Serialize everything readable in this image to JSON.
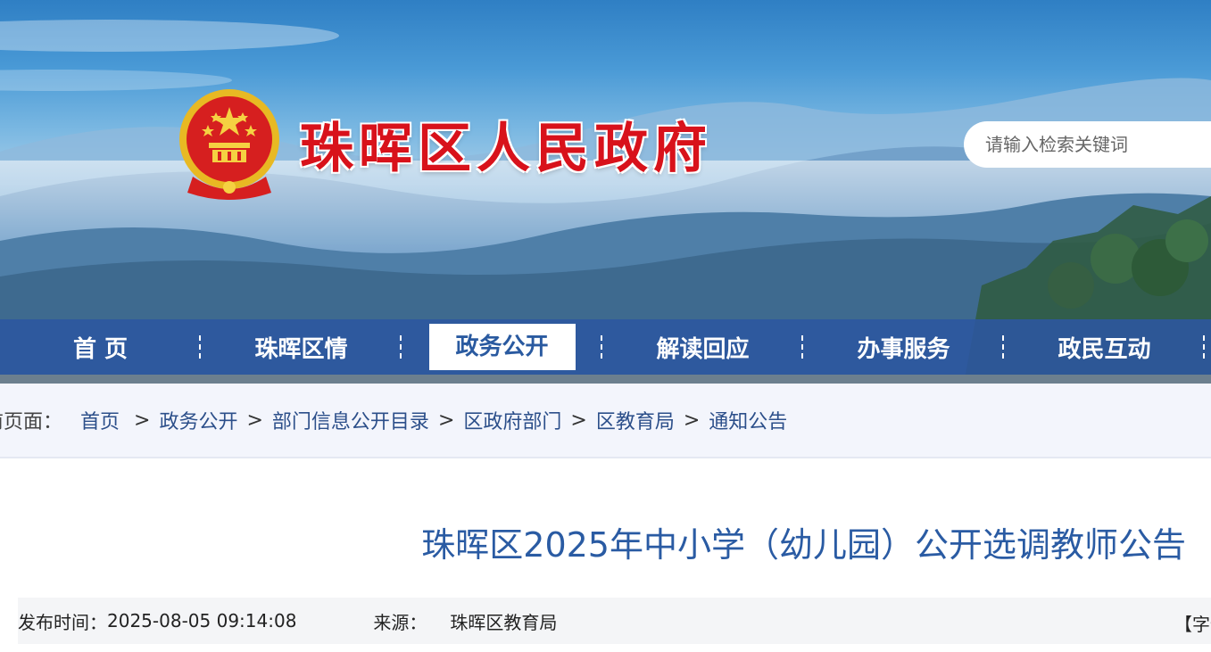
{
  "header": {
    "site_title": "珠晖区人民政府",
    "search_placeholder": "请输入检索关键词"
  },
  "nav": {
    "items": [
      {
        "label": "首 页",
        "active": false
      },
      {
        "label": "珠晖区情",
        "active": false
      },
      {
        "label": "政务公开",
        "active": true
      },
      {
        "label": "解读回应",
        "active": false
      },
      {
        "label": "办事服务",
        "active": false
      },
      {
        "label": "政民互动",
        "active": false
      }
    ]
  },
  "breadcrumb": {
    "prefix": "前页面：",
    "items": [
      "首页",
      "政务公开",
      "部门信息公开目录",
      "区政府部门",
      "区教育局",
      "通知公告"
    ],
    "separator": ">"
  },
  "article": {
    "title": "珠晖区2025年中小学（幼儿园）公开选调教师公告",
    "publish_label": "发布时间：",
    "publish_time": "2025-08-05 09:14:08",
    "source_label": "来源：",
    "source": "珠晖区教育局",
    "font_size_label": "【字体"
  },
  "colors": {
    "nav_bg": "#2c56a0",
    "title_red": "#d8121b",
    "link_blue": "#2c4f8a",
    "article_title_blue": "#2a5ba3"
  }
}
